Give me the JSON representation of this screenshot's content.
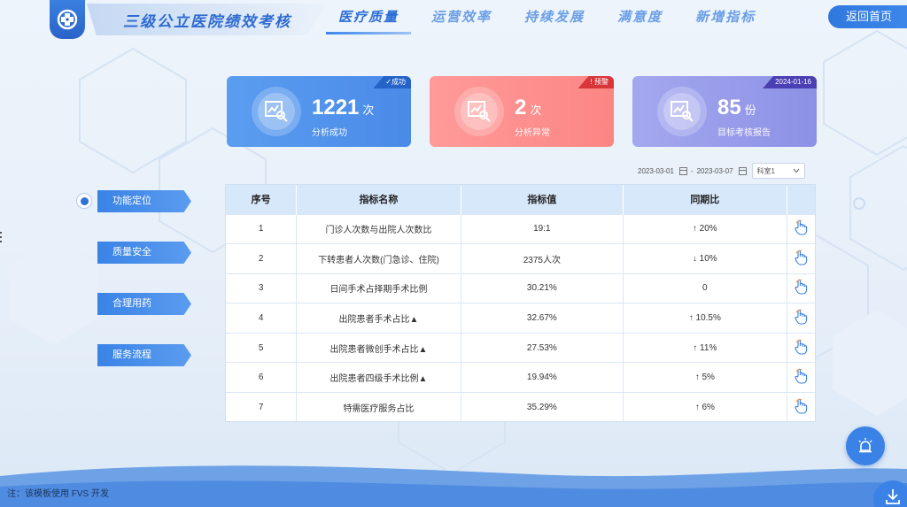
{
  "header": {
    "app_title": "三级公立医院绩效考核",
    "nav": [
      {
        "label": "医疗质量",
        "active": true
      },
      {
        "label": "运营效率",
        "active": false
      },
      {
        "label": "持续发展",
        "active": false
      },
      {
        "label": "满意度",
        "active": false
      },
      {
        "label": "新增指标",
        "active": false
      }
    ],
    "home_label": "返回首页"
  },
  "cards": [
    {
      "value": "1221",
      "unit": "次",
      "label": "分析成功",
      "badge": "✓成功",
      "color": "#5b9df0"
    },
    {
      "value": "2",
      "unit": "次",
      "label": "分析异常",
      "badge": "! 预警",
      "color": "#fb8684"
    },
    {
      "value": "85",
      "unit": "份",
      "label": "目标考核报告",
      "badge": "2024-01-16",
      "color": "#8d91e6"
    }
  ],
  "filters": {
    "date_start": "2023-03-01",
    "date_sep": "-",
    "date_end": "2023-03-07",
    "select_value": "科室1"
  },
  "side_menu": {
    "items": [
      {
        "label": "功能定位",
        "selected": true
      },
      {
        "label": "质量安全",
        "selected": false
      },
      {
        "label": "合理用药",
        "selected": false
      },
      {
        "label": "服务流程",
        "selected": false
      }
    ]
  },
  "table": {
    "headers": [
      "序号",
      "指标名称",
      "指标值",
      "同期比",
      ""
    ],
    "rows": [
      {
        "idx": "1",
        "name": "门诊人次数与出院人次数比",
        "value": "19:1",
        "cmp": "↑ 20%"
      },
      {
        "idx": "2",
        "name": "下转患者人次数(门急诊、住院)",
        "value": "2375人次",
        "cmp": "↓ 10%"
      },
      {
        "idx": "3",
        "name": "日间手术占择期手术比例",
        "value": "30.21%",
        "cmp": "0"
      },
      {
        "idx": "4",
        "name": "出院患者手术占比▲",
        "value": "32.67%",
        "cmp": "↑ 10.5%"
      },
      {
        "idx": "5",
        "name": "出院患者微创手术占比▲",
        "value": "27.53%",
        "cmp": "↑ 11%"
      },
      {
        "idx": "6",
        "name": "出院患者四级手术比例▲",
        "value": "19.94%",
        "cmp": "↑ 5%"
      },
      {
        "idx": "7",
        "name": "特需医疗服务占比",
        "value": "35.29%",
        "cmp": "↑ 6%"
      }
    ]
  },
  "footer": {
    "note": "注：该模板使用 FVS 开发"
  },
  "icons": {
    "logo": "hospital-logo-icon",
    "card": "chart-search-icon",
    "row_action": "pointing-hand-icon",
    "alarm": "alarm-light-icon",
    "download": "download-icon"
  }
}
